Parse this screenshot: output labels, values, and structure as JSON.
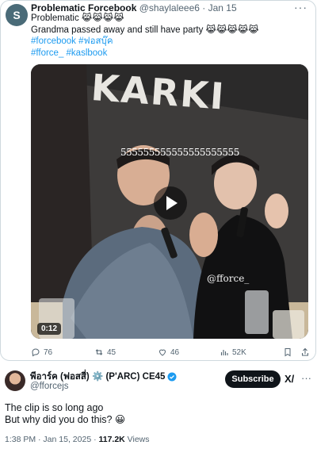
{
  "quoted_tweet": {
    "avatar_letter": "S",
    "display_name": "Problematic Forcebook",
    "handle_date": "@shaylaleee6 · Jan 15",
    "more_icon": "more-horizontal-icon",
    "lines": [
      "Problematic 😹😹😹😹",
      "Grandma passed away and still have party 😹😹😹😹😹"
    ],
    "hashtag_lines": [
      "#forcebook #ฟอสบุ๊ค",
      "#fforce_ #kaslbook"
    ],
    "video": {
      "sign_text": "KARKI",
      "caption": "555555555555555555555",
      "watermark": "@fforce_",
      "duration": "0:12"
    },
    "actions": {
      "replies": "76",
      "reposts": "45",
      "likes": "46",
      "views": "52K"
    }
  },
  "tweet": {
    "display_name": "พีอาร์ค (ฟอสสี่) ⚙️ (P'ARC) CE45",
    "handle": "@fforcejs",
    "subscribe_label": "Subscribe",
    "grok_label": "X/",
    "lines": [
      "The clip is so long ago",
      "But why did you do this? 😀"
    ],
    "meta_time": "1:38 PM · Jan 15, 2025 · ",
    "meta_views": "117.2K",
    "meta_views_label": " Views"
  },
  "colors": {
    "accent": "#1d9bf0",
    "text": "#0f1419",
    "muted": "#536471",
    "border": "#cfd9de"
  }
}
